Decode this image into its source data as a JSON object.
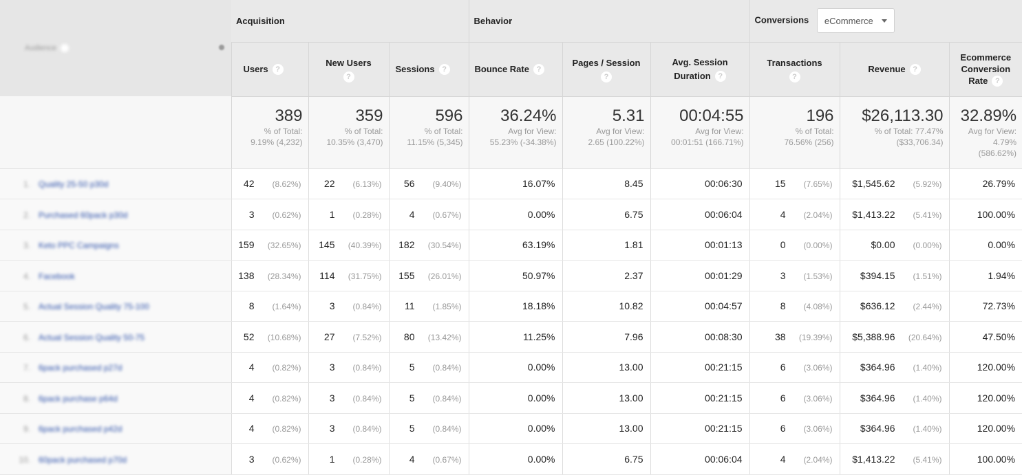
{
  "groups": {
    "acquisition": "Acquisition",
    "behavior": "Behavior",
    "conversions": "Conversions",
    "conversions_select": "eCommerce"
  },
  "audience_header": "Audience",
  "columns": {
    "users": "Users",
    "new_users": "New Users",
    "sessions": "Sessions",
    "bounce_rate": "Bounce Rate",
    "pages_session": "Pages / Session",
    "avg_session_line1": "Avg. Session",
    "avg_session_line2": "Duration",
    "transactions": "Transactions",
    "revenue": "Revenue",
    "ecr_line1": "Ecommerce",
    "ecr_line2": "Conversion",
    "ecr_line3": "Rate",
    "help": "?"
  },
  "summary": {
    "users": {
      "value": "389",
      "l1": "% of Total:",
      "l2": "9.19% (4,232)"
    },
    "new_users": {
      "value": "359",
      "l1": "% of Total:",
      "l2": "10.35% (3,470)"
    },
    "sessions": {
      "value": "596",
      "l1": "% of Total:",
      "l2": "11.15% (5,345)"
    },
    "bounce_rate": {
      "value": "36.24%",
      "l1": "Avg for View:",
      "l2": "55.23% (-34.38%)"
    },
    "pages_session": {
      "value": "5.31",
      "l1": "Avg for View:",
      "l2": "2.65 (100.22%)"
    },
    "avg_session": {
      "value": "00:04:55",
      "l1": "Avg for View:",
      "l2": "00:01:51 (166.71%)"
    },
    "transactions": {
      "value": "196",
      "l1": "% of Total:",
      "l2": "76.56% (256)"
    },
    "revenue": {
      "value": "$26,113.30",
      "l1": "% of Total: 77.47%",
      "l2": "($33,706.34)"
    },
    "ecr": {
      "value": "32.89%",
      "l1": "Avg for View:",
      "l2": "4.79%",
      "l3": "(586.62%)"
    }
  },
  "rows": [
    {
      "n": "1.",
      "name": "Quality 25-50 p30d",
      "users": "42",
      "users_pct": "(8.62%)",
      "new": "22",
      "new_pct": "(6.13%)",
      "sess": "56",
      "sess_pct": "(9.40%)",
      "bounce": "16.07%",
      "pages": "8.45",
      "dur": "00:06:30",
      "trans": "15",
      "trans_pct": "(7.65%)",
      "rev": "$1,545.62",
      "rev_pct": "(5.92%)",
      "ecr": "26.79%"
    },
    {
      "n": "2.",
      "name": "Purchased 60pack p30d",
      "users": "3",
      "users_pct": "(0.62%)",
      "new": "1",
      "new_pct": "(0.28%)",
      "sess": "4",
      "sess_pct": "(0.67%)",
      "bounce": "0.00%",
      "pages": "6.75",
      "dur": "00:06:04",
      "trans": "4",
      "trans_pct": "(2.04%)",
      "rev": "$1,413.22",
      "rev_pct": "(5.41%)",
      "ecr": "100.00%"
    },
    {
      "n": "3.",
      "name": "Keto PPC Campaigns",
      "users": "159",
      "users_pct": "(32.65%)",
      "new": "145",
      "new_pct": "(40.39%)",
      "sess": "182",
      "sess_pct": "(30.54%)",
      "bounce": "63.19%",
      "pages": "1.81",
      "dur": "00:01:13",
      "trans": "0",
      "trans_pct": "(0.00%)",
      "rev": "$0.00",
      "rev_pct": "(0.00%)",
      "ecr": "0.00%"
    },
    {
      "n": "4.",
      "name": "Facebook",
      "users": "138",
      "users_pct": "(28.34%)",
      "new": "114",
      "new_pct": "(31.75%)",
      "sess": "155",
      "sess_pct": "(26.01%)",
      "bounce": "50.97%",
      "pages": "2.37",
      "dur": "00:01:29",
      "trans": "3",
      "trans_pct": "(1.53%)",
      "rev": "$394.15",
      "rev_pct": "(1.51%)",
      "ecr": "1.94%"
    },
    {
      "n": "5.",
      "name": "Actual Session Quality 75-100",
      "users": "8",
      "users_pct": "(1.64%)",
      "new": "3",
      "new_pct": "(0.84%)",
      "sess": "11",
      "sess_pct": "(1.85%)",
      "bounce": "18.18%",
      "pages": "10.82",
      "dur": "00:04:57",
      "trans": "8",
      "trans_pct": "(4.08%)",
      "rev": "$636.12",
      "rev_pct": "(2.44%)",
      "ecr": "72.73%"
    },
    {
      "n": "6.",
      "name": "Actual Session Quality 50-75",
      "users": "52",
      "users_pct": "(10.68%)",
      "new": "27",
      "new_pct": "(7.52%)",
      "sess": "80",
      "sess_pct": "(13.42%)",
      "bounce": "11.25%",
      "pages": "7.96",
      "dur": "00:08:30",
      "trans": "38",
      "trans_pct": "(19.39%)",
      "rev": "$5,388.96",
      "rev_pct": "(20.64%)",
      "ecr": "47.50%"
    },
    {
      "n": "7.",
      "name": "6pack purchased p27d",
      "users": "4",
      "users_pct": "(0.82%)",
      "new": "3",
      "new_pct": "(0.84%)",
      "sess": "5",
      "sess_pct": "(0.84%)",
      "bounce": "0.00%",
      "pages": "13.00",
      "dur": "00:21:15",
      "trans": "6",
      "trans_pct": "(3.06%)",
      "rev": "$364.96",
      "rev_pct": "(1.40%)",
      "ecr": "120.00%"
    },
    {
      "n": "8.",
      "name": "6pack purchase p64d",
      "users": "4",
      "users_pct": "(0.82%)",
      "new": "3",
      "new_pct": "(0.84%)",
      "sess": "5",
      "sess_pct": "(0.84%)",
      "bounce": "0.00%",
      "pages": "13.00",
      "dur": "00:21:15",
      "trans": "6",
      "trans_pct": "(3.06%)",
      "rev": "$364.96",
      "rev_pct": "(1.40%)",
      "ecr": "120.00%"
    },
    {
      "n": "9.",
      "name": "6pack purchased p42d",
      "users": "4",
      "users_pct": "(0.82%)",
      "new": "3",
      "new_pct": "(0.84%)",
      "sess": "5",
      "sess_pct": "(0.84%)",
      "bounce": "0.00%",
      "pages": "13.00",
      "dur": "00:21:15",
      "trans": "6",
      "trans_pct": "(3.06%)",
      "rev": "$364.96",
      "rev_pct": "(1.40%)",
      "ecr": "120.00%"
    },
    {
      "n": "10.",
      "name": "60pack purchased p70d",
      "users": "3",
      "users_pct": "(0.62%)",
      "new": "1",
      "new_pct": "(0.28%)",
      "sess": "4",
      "sess_pct": "(0.67%)",
      "bounce": "0.00%",
      "pages": "6.75",
      "dur": "00:06:04",
      "trans": "4",
      "trans_pct": "(2.04%)",
      "rev": "$1,413.22",
      "rev_pct": "(5.41%)",
      "ecr": "100.00%"
    }
  ]
}
